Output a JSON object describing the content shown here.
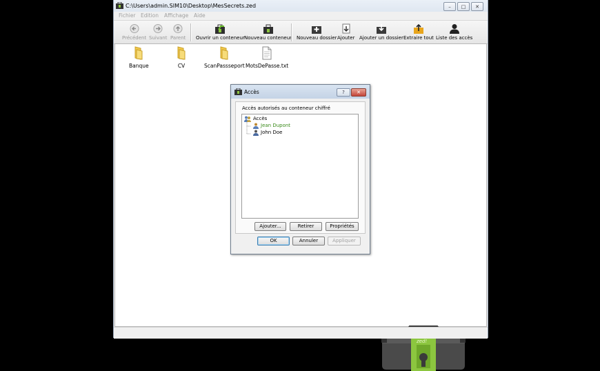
{
  "window": {
    "title": "C:\\Users\\admin.SIM10\\Desktop\\MesSecrets.zed",
    "minimize": "–",
    "maximize": "□",
    "close": "✕"
  },
  "menu": [
    "Fichier",
    "Edition",
    "Affichage",
    "Aide"
  ],
  "toolbar": {
    "back": "Précédent",
    "forward": "Suivant",
    "parent": "Parent",
    "open_container": "Ouvrir un conteneur",
    "new_container": "Nouveau conteneur",
    "new_folder": "Nouveau dossier",
    "add": "Ajouter",
    "add_folder": "Ajouter un dossier",
    "extract_all": "Extraire tout",
    "access_list": "Liste des accès"
  },
  "files": [
    {
      "name": "Banque",
      "type": "folder"
    },
    {
      "name": "CV",
      "type": "folder"
    },
    {
      "name": "ScanPassseport",
      "type": "folder"
    },
    {
      "name": "MotsDePasse.txt",
      "type": "file"
    }
  ],
  "dialog": {
    "title": "Accès",
    "help": "?",
    "close": "✕",
    "group_label": "Accès autorisés au conteneur chiffré",
    "tree_root": "Accès",
    "users": [
      "Jean Dupont",
      "John Doe"
    ],
    "btn_add": "Ajouter...",
    "btn_remove": "Retirer",
    "btn_props": "Propriétés",
    "btn_ok": "OK",
    "btn_cancel": "Annuler",
    "btn_apply": "Appliquer"
  },
  "brand_logo": "zed!",
  "colors": {
    "selected_user": "#3a8a1a",
    "bag_green": "#8cc63f"
  }
}
